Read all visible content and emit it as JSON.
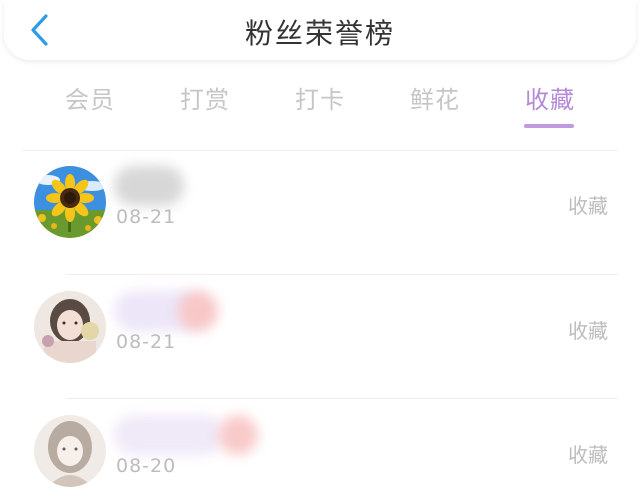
{
  "header": {
    "title": "粉丝荣誉榜"
  },
  "tabs": [
    {
      "label": "会员",
      "active": false
    },
    {
      "label": "打赏",
      "active": false
    },
    {
      "label": "打卡",
      "active": false
    },
    {
      "label": "鲜花",
      "active": false
    },
    {
      "label": "收藏",
      "active": true
    }
  ],
  "colors": {
    "accent": "#b48ad6",
    "back_icon": "#2e9be6",
    "muted_text": "#bdbdbd"
  },
  "list": [
    {
      "date": "08-21",
      "action": "收藏",
      "avatar_icon": "sunflower-avatar"
    },
    {
      "date": "08-21",
      "action": "收藏",
      "avatar_icon": "portrait-avatar"
    },
    {
      "date": "08-20",
      "action": "收藏",
      "avatar_icon": "sketch-portrait-avatar"
    }
  ]
}
